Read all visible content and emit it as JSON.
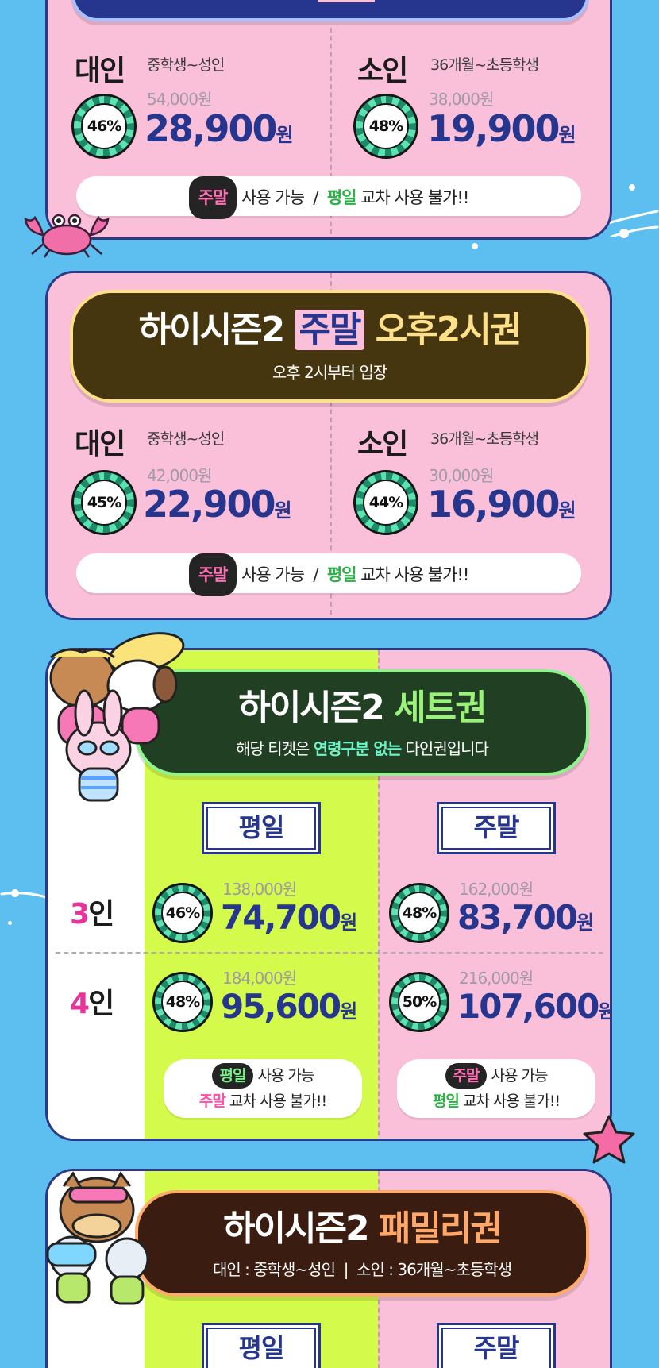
{
  "weekend_pm": {
    "adult_label": "대인",
    "adult_desc": "중학생~성인",
    "child_label": "소인",
    "child_desc": "36개월~초등학생",
    "adult_badge": "46%",
    "adult_orig": "54,000원",
    "adult_price": "28,900",
    "child_badge": "48%",
    "child_orig": "38,000원",
    "child_price": "19,900",
    "won": "원",
    "notice_pill": "주말",
    "notice_mid": " 사용 가능  /  ",
    "notice_green": "평일",
    "notice_end": " 교차 사용 불가!!"
  },
  "weekend_2pm": {
    "title_a": "하이시즌2 ",
    "title_hl": "주말",
    "title_b": " 오후2시권",
    "subtitle": "오후 2시부터 입장",
    "adult_label": "대인",
    "adult_desc": "중학생~성인",
    "child_label": "소인",
    "child_desc": "36개월~초등학생",
    "adult_badge": "45%",
    "adult_orig": "42,000원",
    "adult_price": "22,900",
    "child_badge": "44%",
    "child_orig": "30,000원",
    "child_price": "16,900",
    "won": "원",
    "notice_pill": "주말",
    "notice_mid": " 사용 가능  /  ",
    "notice_green": "평일",
    "notice_end": " 교차 사용 불가!!"
  },
  "set_ticket": {
    "title_a": "하이시즌2 ",
    "title_b": "세트권",
    "subtitle_a": "해당 티켓은 ",
    "subtitle_em": "연령구분 없는",
    "subtitle_b": " 다인권입니다",
    "weekday_tab": "평일",
    "weekend_tab": "주말",
    "row3_num": "3",
    "row4_num": "4",
    "people_suffix": "인",
    "wd3_badge": "46%",
    "wd3_orig": "138,000원",
    "wd3_price": "74,700",
    "we3_badge": "48%",
    "we3_orig": "162,000원",
    "we3_price": "83,700",
    "wd4_badge": "48%",
    "wd4_orig": "184,000원",
    "wd4_price": "95,600",
    "we4_badge": "50%",
    "we4_orig": "216,000원",
    "we4_price": "107,600",
    "won": "원",
    "wd_notice_pill": "평일",
    "wd_notice_line1": " 사용 가능",
    "wd_notice_pink": "주말",
    "wd_notice_line2": " 교차 사용 불가!!",
    "we_notice_pill": "주말",
    "we_notice_line1": " 사용 가능",
    "we_notice_green": "평일",
    "we_notice_line2": " 교차 사용 불가!!"
  },
  "family_ticket": {
    "title_a": "하이시즌2 ",
    "title_b": "패밀리권",
    "subtitle": "대인 : 중학생~성인  |  소인 : 36개월~초등학생",
    "weekday_tab": "평일",
    "weekend_tab": "주말"
  },
  "colors": {
    "background": "#5cbff0",
    "card_pink": "#fbc0d9",
    "navy": "#26368e",
    "lime": "#d4fb4b"
  }
}
